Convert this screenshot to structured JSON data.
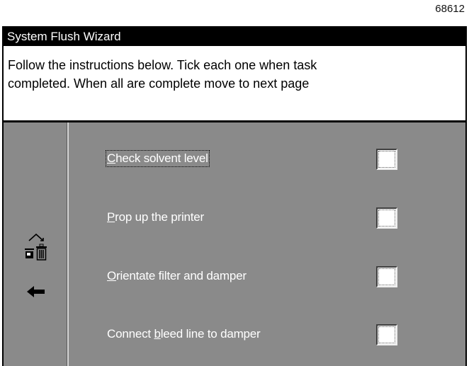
{
  "figure_id": "68612",
  "window": {
    "title": "System Flush Wizard",
    "instructions_line1": "Follow the instructions below. Tick each one when task",
    "instructions_line2": "completed. When all are complete move to next page"
  },
  "nav_icons": [
    "up-icon",
    "delete-icon",
    "back-arrow-icon"
  ],
  "tasks": [
    {
      "accesskey": "C",
      "rest": "heck solvent level",
      "prefix": "",
      "checked": false
    },
    {
      "accesskey": "P",
      "rest": "rop up the printer",
      "prefix": "",
      "checked": false
    },
    {
      "accesskey": "O",
      "rest": "rientate filter and damper",
      "prefix": "",
      "checked": false
    },
    {
      "accesskey": "b",
      "rest": "leed line to damper",
      "prefix": "Connect ",
      "checked": false
    }
  ],
  "colors": {
    "titlebar": "#000000",
    "panel": "#8a8a8a",
    "text_on_panel": "#ffffff"
  }
}
